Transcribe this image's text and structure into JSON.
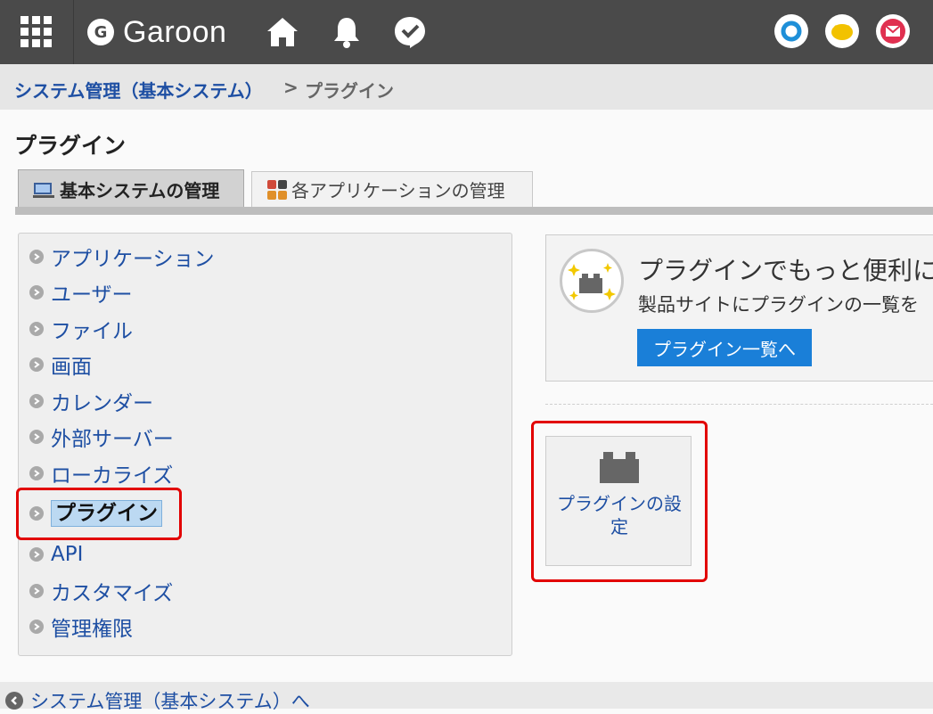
{
  "header": {
    "logo_mark": "G",
    "app_name": "Garoon"
  },
  "breadcrumb": {
    "parent": "システム管理（基本システム）",
    "separator": ">",
    "current": "プラグイン"
  },
  "page_title": "プラグイン",
  "tabs": [
    {
      "label": "基本システムの管理",
      "active": true
    },
    {
      "label": "各アプリケーションの管理",
      "active": false
    }
  ],
  "menu": [
    {
      "label": "アプリケーション"
    },
    {
      "label": "ユーザー"
    },
    {
      "label": "ファイル"
    },
    {
      "label": "画面"
    },
    {
      "label": "カレンダー"
    },
    {
      "label": "外部サーバー"
    },
    {
      "label": "ローカライズ"
    },
    {
      "label": "プラグイン",
      "selected": true
    },
    {
      "label": "API"
    },
    {
      "label": "カスタマイズ"
    },
    {
      "label": "管理権限"
    }
  ],
  "promo": {
    "title": "プラグインでもっと便利にG",
    "text": "製品サイトにプラグインの一覧を",
    "button": "プラグイン一覧へ"
  },
  "tile": {
    "label": "プラグインの設定"
  },
  "footer": {
    "back_link": "システム管理（基本システム）へ"
  },
  "colors": {
    "header_bg": "#4a4a4a",
    "link": "#1e4fa3",
    "button": "#1a7fd8",
    "highlight_box": "#e20000"
  }
}
